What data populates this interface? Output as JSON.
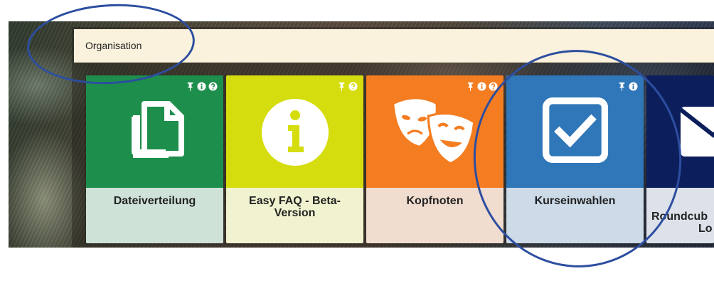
{
  "section": {
    "title": "Organisation"
  },
  "tiles": [
    {
      "title": "Dateiverteilung",
      "icon": "copy-files-icon",
      "color": "#1e8e4c",
      "bottom_color": "#cfe2d8",
      "badges": [
        "pin-icon",
        "info-icon",
        "help-icon"
      ]
    },
    {
      "title": "Easy FAQ - Beta-Version",
      "icon": "info-circle-icon",
      "color": "#d6dd0e",
      "bottom_color": "#f1f2cf",
      "badges": [
        "pin-icon",
        "help-icon"
      ]
    },
    {
      "title": "Kopfnoten",
      "icon": "theater-masks-icon",
      "color": "#f47d22",
      "bottom_color": "#f1ddd0",
      "badges": [
        "pin-icon",
        "info-icon",
        "help-icon"
      ]
    },
    {
      "title": "Kurseinwahlen",
      "icon": "checkbox-icon",
      "color": "#2f77b8",
      "bottom_color": "#cddae8",
      "badges": [
        "pin-icon",
        "info-icon"
      ]
    },
    {
      "title": "Roundcube Login",
      "title_visible_lines": [
        "Roundcub",
        "Lo"
      ],
      "icon": "envelope-icon",
      "color": "#0c1f5c",
      "bottom_color": "#dde2ea",
      "badges": []
    }
  ],
  "annotation_color": "#2d4ea0"
}
